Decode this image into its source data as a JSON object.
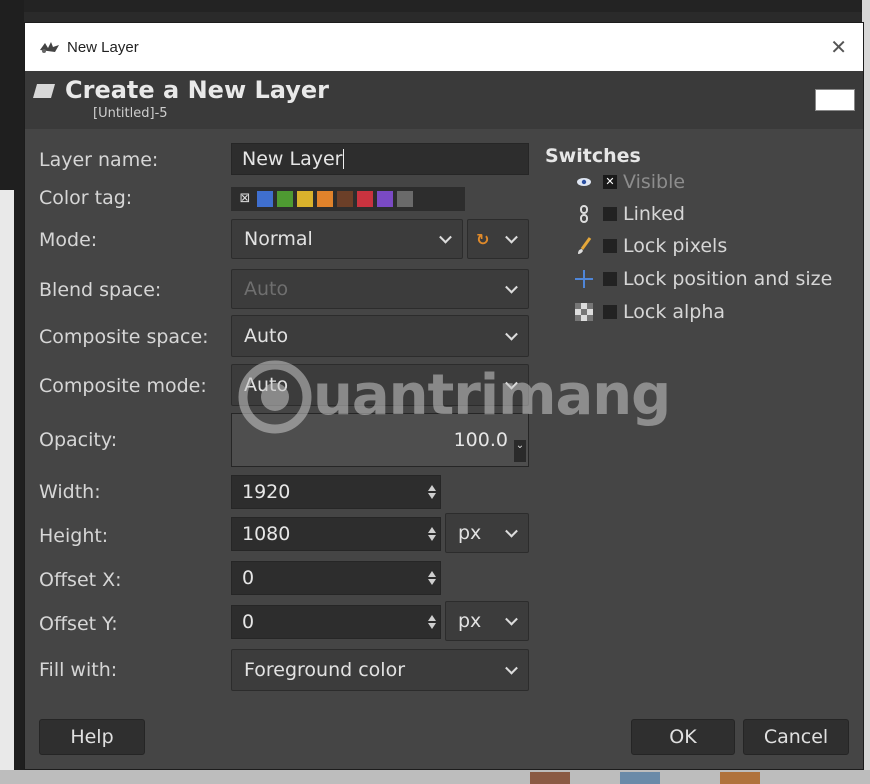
{
  "window": {
    "title": "New Layer"
  },
  "header": {
    "title": "Create a New Layer",
    "subtitle": "[Untitled]-5"
  },
  "form": {
    "layer_name": {
      "label": "Layer name:",
      "value": "New Layer"
    },
    "color_tag": {
      "label": "Color tag:",
      "options": [
        "none",
        "#3f6fcf",
        "#4e9a32",
        "#d9b22c",
        "#e0822b",
        "#6b3f28",
        "#c9333f",
        "#7a4ac4",
        "#6a6a6a"
      ]
    },
    "mode": {
      "label": "Mode:",
      "value": "Normal"
    },
    "blend_space": {
      "label": "Blend space:",
      "value": "Auto"
    },
    "composite_space": {
      "label": "Composite space:",
      "value": "Auto"
    },
    "composite_mode": {
      "label": "Composite mode:",
      "value": "Auto"
    },
    "opacity": {
      "label": "Opacity:",
      "value": "100.0",
      "level": 1.0
    },
    "width": {
      "label": "Width:",
      "value": "1920"
    },
    "height": {
      "label": "Height:",
      "value": "1080",
      "unit": "px"
    },
    "offset_x": {
      "label": "Offset X:",
      "value": "0"
    },
    "offset_y": {
      "label": "Offset Y:",
      "value": "0",
      "unit": "px"
    },
    "fill_with": {
      "label": "Fill with:",
      "value": "Foreground color"
    }
  },
  "switches": {
    "title": "Switches",
    "items": [
      {
        "icon": "eye-icon",
        "label": "Visible",
        "checked": true
      },
      {
        "icon": "chain-link-icon",
        "label": "Linked",
        "checked": false
      },
      {
        "icon": "paintbrush-icon",
        "label": "Lock pixels",
        "checked": false
      },
      {
        "icon": "move-cross-icon",
        "label": "Lock position and size",
        "checked": false
      },
      {
        "icon": "checkerboard-icon",
        "label": "Lock alpha",
        "checked": false
      }
    ]
  },
  "buttons": {
    "help": "Help",
    "ok": "OK",
    "cancel": "Cancel"
  },
  "watermark": {
    "text": "uantrimang"
  }
}
